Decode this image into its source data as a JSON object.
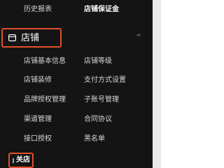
{
  "sidebar": {
    "top_row": {
      "history_report": "历史报表",
      "store_deposit": "店铺保证金"
    },
    "section": {
      "icon": "store-icon",
      "title": "店铺",
      "expanded_icon": "chevron-up-icon",
      "chevron_glyph": "^"
    },
    "items": [
      "店铺基本信息",
      "店铺等级",
      "店铺装修",
      "支付方式设置",
      "品牌授权管理",
      "子账号管理",
      "渠道管理",
      "合同协议",
      "接口授权",
      "黑名单"
    ],
    "close_store": "关店"
  },
  "colors": {
    "sidebar_bg": "#141414",
    "highlight_border": "#e0502a",
    "content_bg": "#ffffff"
  }
}
